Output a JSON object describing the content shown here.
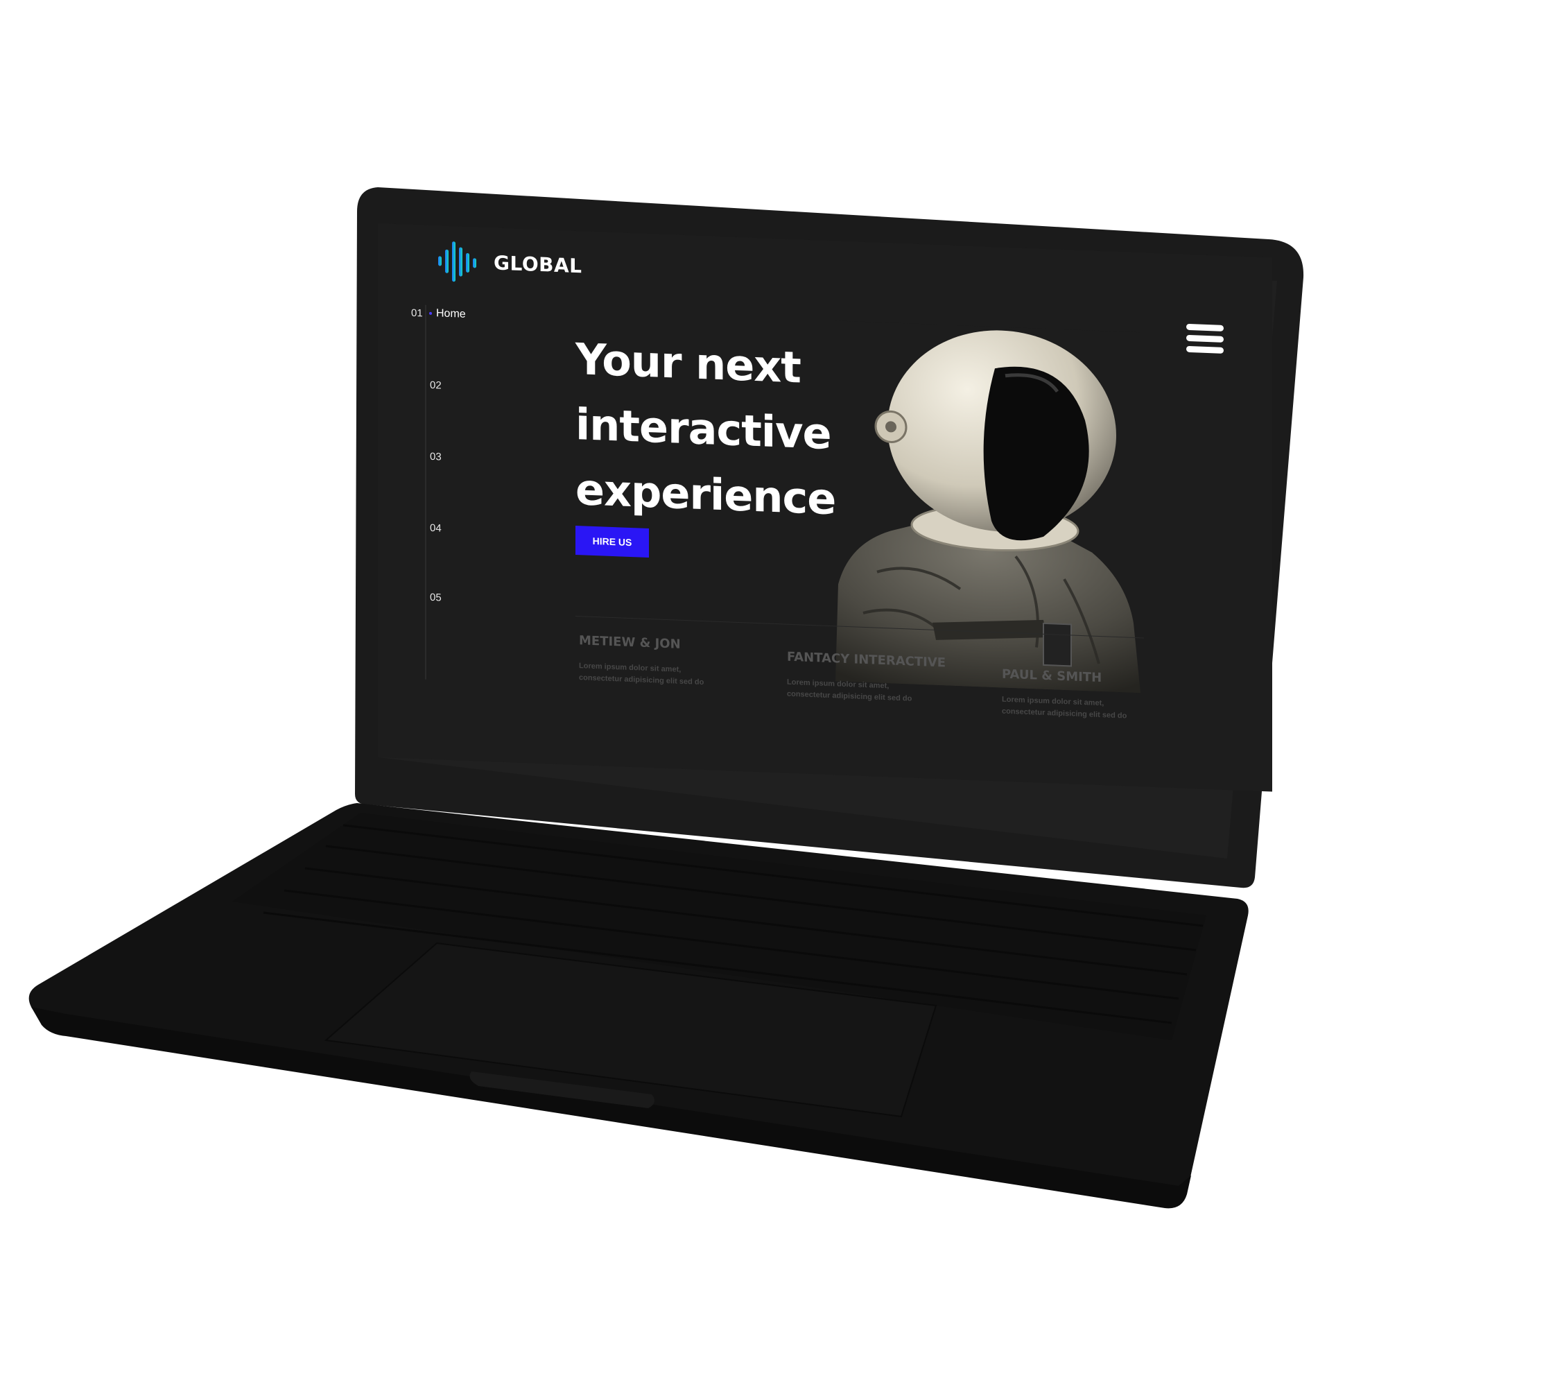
{
  "brand": {
    "name": "GLOBAL",
    "gradient": [
      "#1e7bff",
      "#14d6c0"
    ]
  },
  "nav": {
    "items": [
      {
        "num": "01",
        "label": "Home"
      },
      {
        "num": "02",
        "label": ""
      },
      {
        "num": "03",
        "label": ""
      },
      {
        "num": "04",
        "label": ""
      },
      {
        "num": "05",
        "label": ""
      }
    ],
    "active_dot_color": "#4a3cff"
  },
  "hero": {
    "headline_line1": "Your next",
    "headline_line2": "interactive",
    "headline_line3": "experience",
    "cta_label": "HIRE US",
    "cta_color": "#2a16f5"
  },
  "team": [
    {
      "title": "METIEW & JON",
      "text": "Lorem ipsum dolor sit amet, consectetur adipisicing elit sed do"
    },
    {
      "title": "FANTACY INTERACTIVE",
      "text": "Lorem ipsum dolor sit amet, consectetur adipisicing elit sed do"
    },
    {
      "title": "PAUL &  SMITH",
      "text": "Lorem ipsum dolor sit amet, consectetur adipisicing elit sed do"
    }
  ],
  "icons": {
    "menu": "hamburger-menu-icon",
    "logo": "sound-wave-logo-icon"
  },
  "colors": {
    "screen_bg": "#1d1d1d",
    "laptop_body": "#141414"
  }
}
